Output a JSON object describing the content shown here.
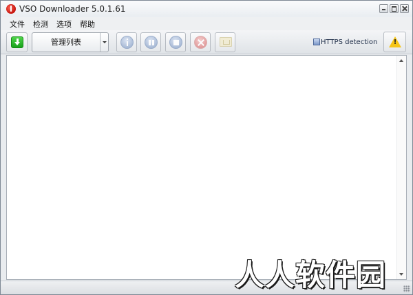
{
  "window": {
    "title": "VSO Downloader 5.0.1.61"
  },
  "menu": {
    "items": [
      "文件",
      "检测",
      "选项",
      "帮助"
    ]
  },
  "toolbar": {
    "list_select_value": "管理列表",
    "https_detection_label": "HTTPS detection",
    "warning_mark": "!",
    "icons": [
      "download-icon",
      "info-icon",
      "pause-icon",
      "stop-icon",
      "delete-icon",
      "folder-icon",
      "warning-icon"
    ]
  },
  "watermark": "人人软件园",
  "colors": {
    "download_green": "#18a11b",
    "warning_yellow": "#f6c517",
    "delete_red": "#e08e8e",
    "content_bg": "#ffffff"
  }
}
